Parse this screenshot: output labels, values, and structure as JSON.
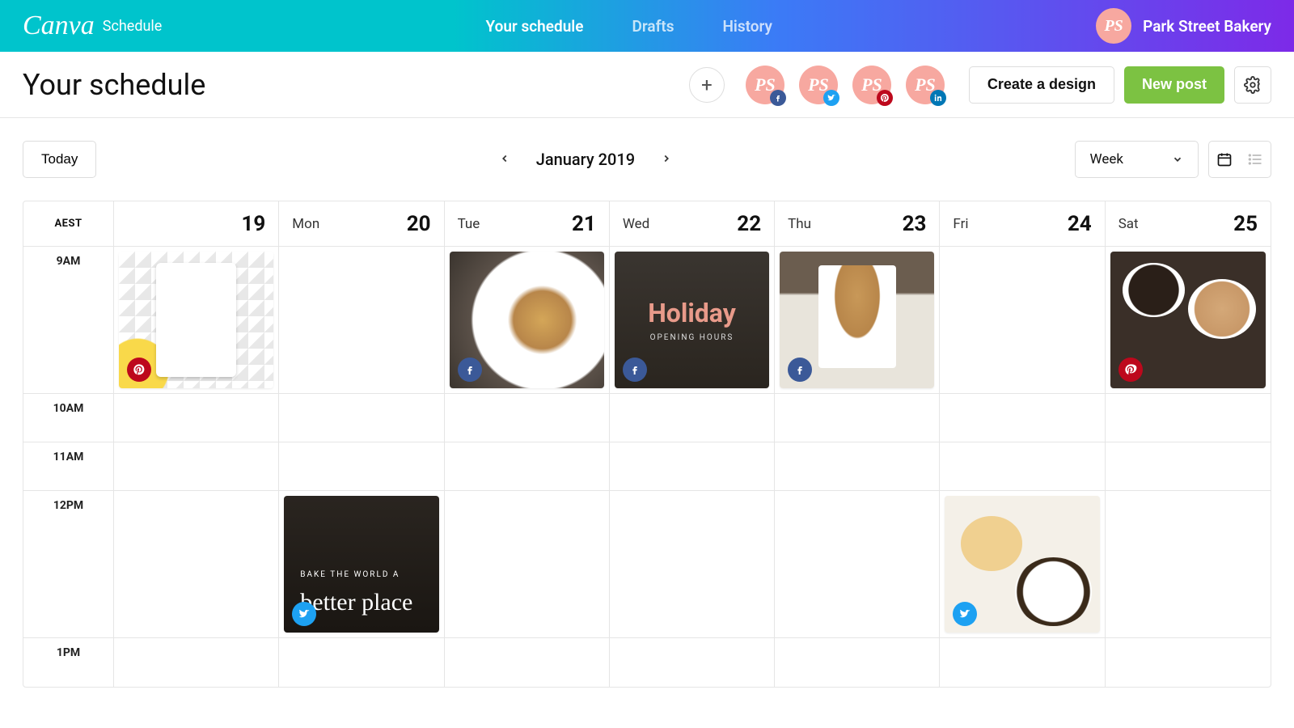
{
  "brand": {
    "logo": "Canva",
    "product": "Schedule"
  },
  "topnav": {
    "schedule": "Your schedule",
    "drafts": "Drafts",
    "history": "History"
  },
  "user": {
    "initials": "PS",
    "name": "Park Street Bakery"
  },
  "page": {
    "title": "Your schedule"
  },
  "actions": {
    "create": "Create a design",
    "newpost": "New post"
  },
  "controls": {
    "today": "Today",
    "period": "January 2019",
    "view": "Week"
  },
  "calendar": {
    "tz": "AEST",
    "days": [
      {
        "dow": "",
        "num": "19"
      },
      {
        "dow": "Mon",
        "num": "20"
      },
      {
        "dow": "Tue",
        "num": "21"
      },
      {
        "dow": "Wed",
        "num": "22"
      },
      {
        "dow": "Thu",
        "num": "23"
      },
      {
        "dow": "Fri",
        "num": "24"
      },
      {
        "dow": "Sat",
        "num": "25"
      }
    ],
    "hours": [
      "9AM",
      "10AM",
      "11AM",
      "12PM",
      "1PM"
    ]
  },
  "posts": {
    "sun_9": {
      "platform": "pinterest"
    },
    "tue_9": {
      "platform": "facebook"
    },
    "wed_9": {
      "platform": "facebook",
      "title": "Holiday",
      "sub": "OPENING HOURS"
    },
    "thu_9": {
      "platform": "facebook"
    },
    "sat_9": {
      "platform": "pinterest"
    },
    "mon_12": {
      "platform": "twitter",
      "line1": "BAKE THE WORLD A",
      "line2": "better place"
    },
    "fri_12": {
      "platform": "twitter"
    }
  },
  "connected_accounts": [
    {
      "initials": "PS",
      "network": "facebook"
    },
    {
      "initials": "PS",
      "network": "twitter"
    },
    {
      "initials": "PS",
      "network": "pinterest"
    },
    {
      "initials": "PS",
      "network": "linkedin"
    }
  ]
}
